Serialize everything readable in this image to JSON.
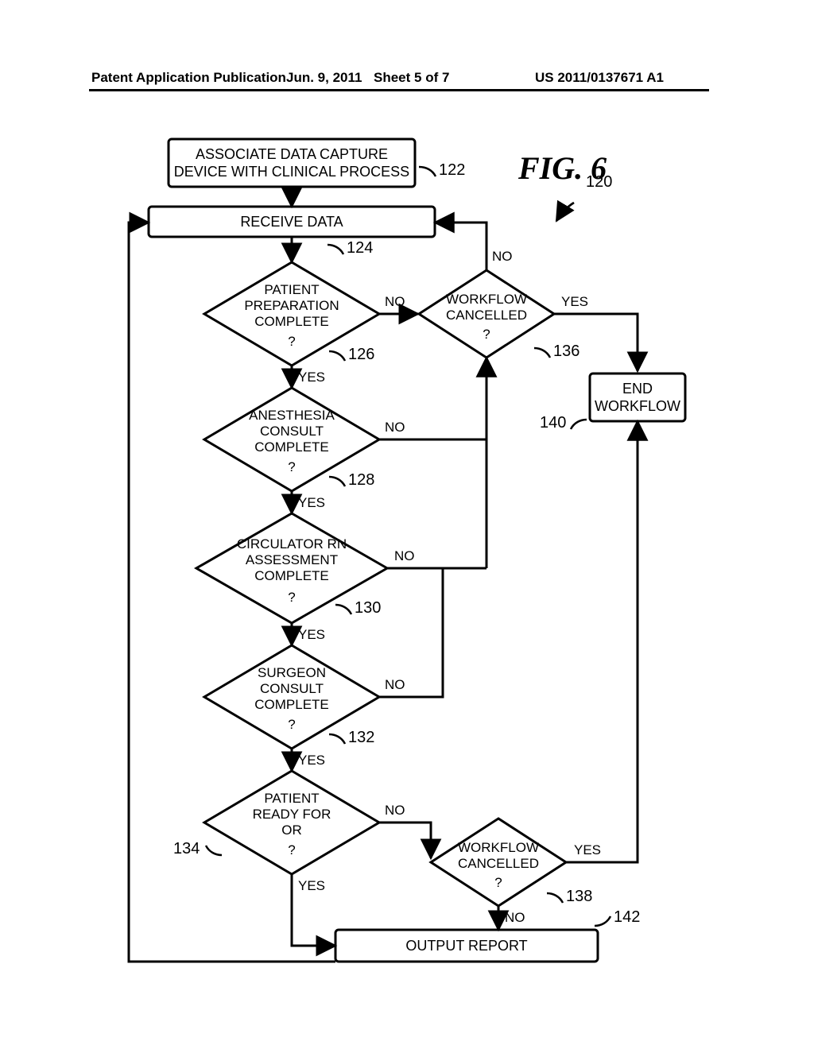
{
  "header": {
    "left": "Patent Application Publication",
    "mid": "Jun. 9, 2011",
    "mid2": "Sheet 5 of 7",
    "right": "US 2011/0137671 A1"
  },
  "figure": {
    "label": "FIG. 6",
    "number": "120"
  },
  "boxes": {
    "b122": {
      "line1": "ASSOCIATE DATA CAPTURE",
      "line2": "DEVICE WITH CLINICAL PROCESS",
      "ref": "122"
    },
    "b124": {
      "line1": "RECEIVE DATA",
      "ref": "124"
    },
    "b140": {
      "line1": "END",
      "line2": "WORKFLOW",
      "ref": "140"
    },
    "b142": {
      "line1": "OUTPUT REPORT",
      "ref": "142"
    }
  },
  "decisions": {
    "d126": {
      "line1": "PATIENT",
      "line2": "PREPARATION",
      "line3": "COMPLETE",
      "line4": "?",
      "ref": "126"
    },
    "d128": {
      "line1": "ANESTHESIA",
      "line2": "CONSULT",
      "line3": "COMPLETE",
      "line4": "?",
      "ref": "128"
    },
    "d130": {
      "line1": "CIRCULATOR RN",
      "line2": "ASSESSMENT",
      "line3": "COMPLETE",
      "line4": "?",
      "ref": "130"
    },
    "d132": {
      "line1": "SURGEON",
      "line2": "CONSULT",
      "line3": "COMPLETE",
      "line4": "?",
      "ref": "132"
    },
    "d134": {
      "line1": "PATIENT",
      "line2": "READY FOR",
      "line3": "OR",
      "line4": "?",
      "ref": "134"
    },
    "d136": {
      "line1": "WORKFLOW",
      "line2": "CANCELLED",
      "line3": "?",
      "ref": "136"
    },
    "d138": {
      "line1": "WORKFLOW",
      "line2": "CANCELLED",
      "line3": "?",
      "ref": "138"
    }
  },
  "labels": {
    "yes": "YES",
    "no": "NO"
  }
}
